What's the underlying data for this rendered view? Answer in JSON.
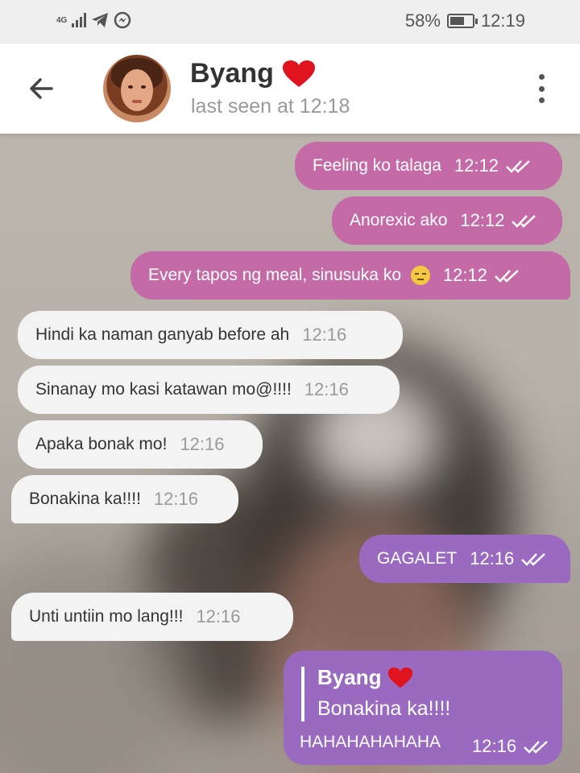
{
  "status_bar": {
    "network": "4G",
    "battery_percent": "58%",
    "time": "12:19",
    "icons": [
      "signal-icon",
      "telegram-icon",
      "messenger-icon",
      "battery-icon"
    ]
  },
  "header": {
    "contact_name": "Byang",
    "last_seen": "last seen at 12:18",
    "icons": [
      "back-arrow-icon",
      "heart-icon",
      "more-options-icon"
    ]
  },
  "colors": {
    "outgoing": "#c46aa6",
    "outgoing_reply": "#9a6ac0",
    "incoming": "#f3f3f3"
  },
  "messages": [
    {
      "direction": "out",
      "text": "Feeling ko talaga",
      "time": "12:12"
    },
    {
      "direction": "out",
      "text": "Anorexic ako",
      "time": "12:12"
    },
    {
      "direction": "out",
      "text": "Every tapos ng meal, sinusuka ko",
      "time": "12:12",
      "emoji": "unamused-face"
    },
    {
      "direction": "in",
      "text": "Hindi ka naman ganyab before ah",
      "time": "12:16"
    },
    {
      "direction": "in",
      "text": "Sinanay mo kasi katawan mo@!!!!",
      "time": "12:16"
    },
    {
      "direction": "in",
      "text": "Apaka bonak mo!",
      "time": "12:16"
    },
    {
      "direction": "in",
      "text": "Bonakina ka!!!!",
      "time": "12:16"
    },
    {
      "direction": "out",
      "text": "GAGALET",
      "time": "12:16"
    },
    {
      "direction": "in",
      "text": "Unti untiin mo lang!!!",
      "time": "12:16"
    },
    {
      "direction": "out",
      "reply_to": {
        "name": "Byang",
        "text": "Bonakina ka!!!!"
      },
      "text": "HAHAHAHAHAHA",
      "time": "12:16"
    }
  ]
}
